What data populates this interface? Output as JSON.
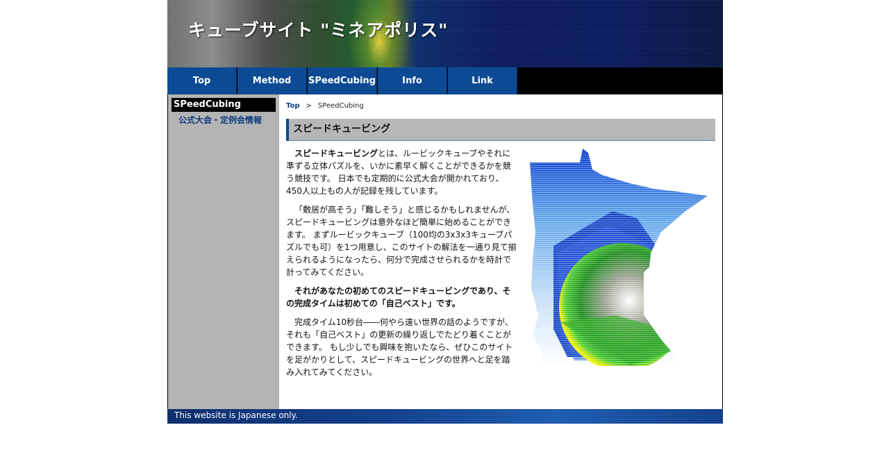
{
  "header": {
    "title": "キューブサイト \"ミネアポリス\""
  },
  "nav": {
    "items": [
      {
        "label": "Top"
      },
      {
        "label": "Method"
      },
      {
        "label": "SPeedCubing"
      },
      {
        "label": "Info"
      },
      {
        "label": "Link"
      }
    ]
  },
  "sidebar": {
    "heading": "SPeedCubing",
    "link": "公式大会・定例会情報"
  },
  "breadcrumb": {
    "top": "Top",
    "separator": ">",
    "current": "SPeedCubing"
  },
  "content": {
    "heading": "スピードキュービング",
    "p1_bold": "スピードキュービング",
    "p1_rest": "とは、ルービックキューブやそれに準ずる立体パズルを、いかに素早く解くことができるかを競う競技です。 日本でも定期的に公式大会が開かれており、450人以上もの人が記録を残しています。",
    "p2": "「敷居が高そう」「難しそう」と感じるかもしれませんが、スピードキュービングは意外なほど簡単に始めることができます。 まずルービックキューブ（100均の3x3x3キューブパズルでも可）を1つ用意し、このサイトの解法を一通り見て揃えられるようになったら、何分で完成させられるかを時計で計ってみてください。",
    "p3": "それがあなたの初めてのスピードキュービングであり、その完成タイムは初めての「自己ベスト」です。",
    "p4": "完成タイム10秒台――何やら遠い世界の話のようですが、それも「自己ベスト」の更新の繰り返しでたどり着くことができます。 もし少しでも興味を抱いたなら、ぜひこのサイトを足がかりとして、スピードキュービングの世界へと足を踏み入れてみてください。"
  },
  "footer": {
    "text": "This website is Japanese only."
  },
  "colors": {
    "nav_blue": "#0d4a94",
    "sidebar_gray": "#b4b4b4",
    "link_blue": "#0d3c80"
  }
}
